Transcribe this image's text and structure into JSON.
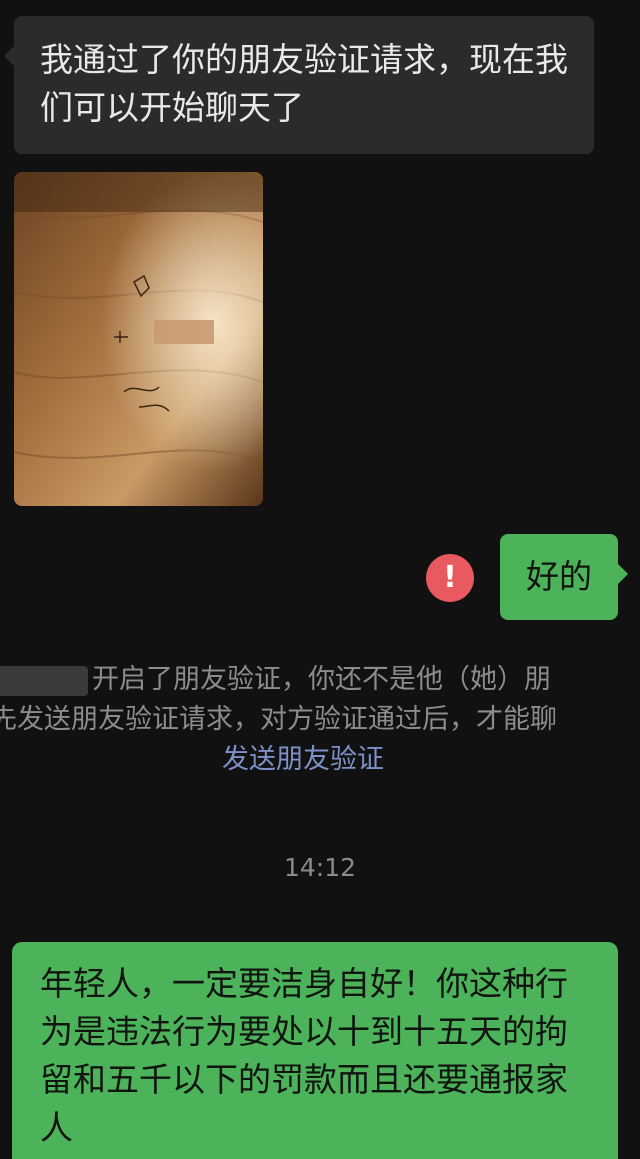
{
  "messages": {
    "incoming_text": "我通过了你的朋友验证请求，现在我们可以开始聊天了",
    "outgoing_short": "好的",
    "alert_symbol": "!",
    "system_line1": "开启了朋友验证，你还不是他（她）朋",
    "system_line1_prefix": "",
    "system_line2": "先发送朋友验证请求，对方验证通过后，才能聊",
    "system_link": "发送朋友验证",
    "timestamp": "14:12",
    "outgoing_long": "年轻人，一定要洁身自好！你这种行为是违法行为要处以十到十五天的拘留和五千以下的罚款而且还要通报家人"
  },
  "icons": {
    "alert": "exclamation-icon"
  },
  "colors": {
    "background": "#111111",
    "incoming_bubble": "#2b2b2b",
    "outgoing_bubble": "#4cb35a",
    "alert": "#e85a5f",
    "link": "#7d90c8"
  }
}
